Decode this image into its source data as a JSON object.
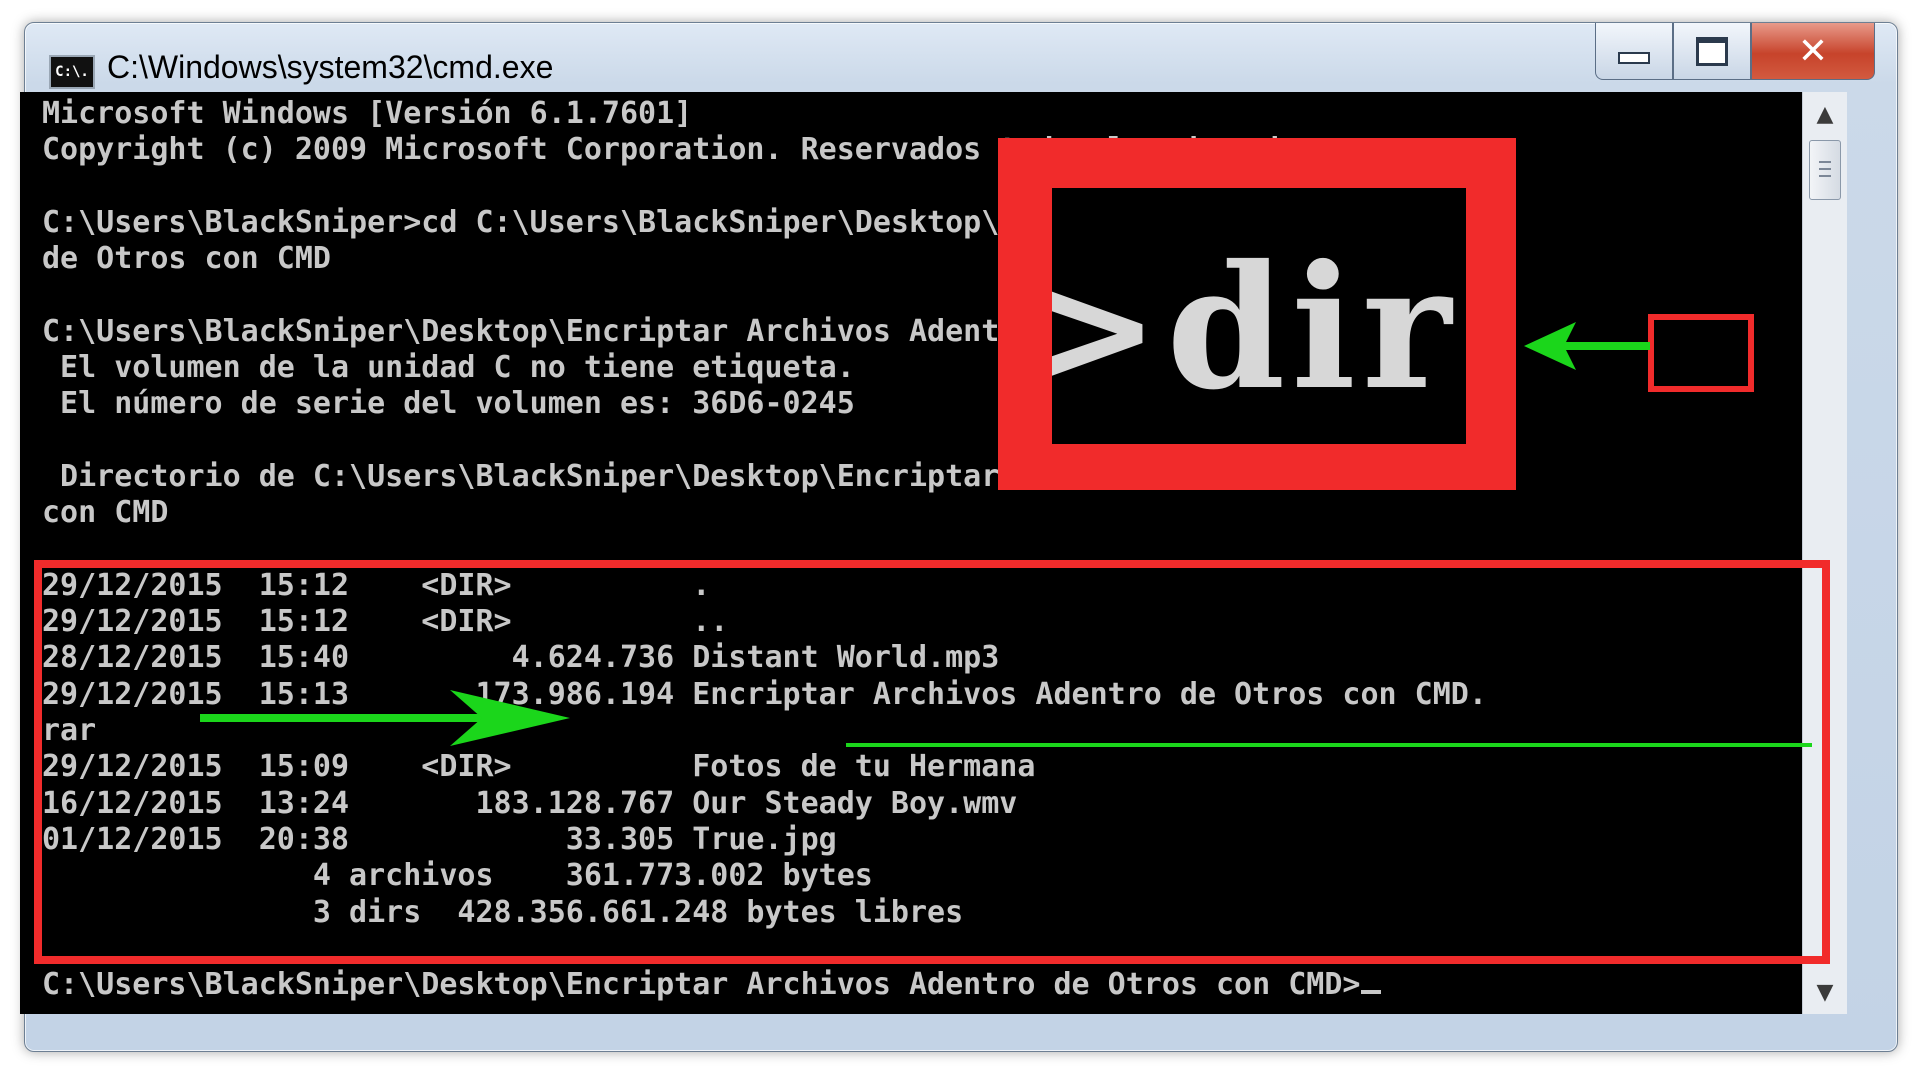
{
  "window": {
    "title": "C:\\Windows\\system32\\cmd.exe",
    "icon_label": "C:\\.",
    "buttons": {
      "minimize": "minimize",
      "maximize": "maximize",
      "close": "✕"
    }
  },
  "console": {
    "lines": [
      "Microsoft Windows [Versión 6.1.7601]",
      "Copyright (c) 2009 Microsoft Corporation. Reservados todos los derechos.",
      "",
      "C:\\Users\\BlackSniper>cd C:\\Users\\BlackSniper\\Desktop\\Encriptar Archivos Adentro",
      "de Otros con CMD",
      "",
      "C:\\Users\\BlackSniper\\Desktop\\Encriptar Archivos Adentro de Otros con CMD>dir",
      " El volumen de la unidad C no tiene etiqueta.",
      " El número de serie del volumen es: 36D6-0245",
      "",
      " Directorio de C:\\Users\\BlackSniper\\Desktop\\Encriptar Archivos Adentro de Otros",
      "con CMD",
      "",
      "29/12/2015  15:12    <DIR>          .",
      "29/12/2015  15:12    <DIR>          ..",
      "28/12/2015  15:40         4.624.736 Distant World.mp3",
      "29/12/2015  15:13       173.986.194 Encriptar Archivos Adentro de Otros con CMD.",
      "rar",
      "29/12/2015  15:09    <DIR>          Fotos de tu Hermana",
      "16/12/2015  13:24       183.128.767 Our Steady Boy.wmv",
      "01/12/2015  20:38            33.305 True.jpg",
      "               4 archivos    361.773.002 bytes",
      "               3 dirs  428.356.661.248 bytes libres",
      "",
      "C:\\Users\\BlackSniper\\Desktop\\Encriptar Archivos Adentro de Otros con CMD>"
    ]
  },
  "annotations": {
    "zoom_text": ">dir",
    "colors": {
      "highlight": "#f12b2b",
      "arrow": "#1bd61b"
    }
  }
}
